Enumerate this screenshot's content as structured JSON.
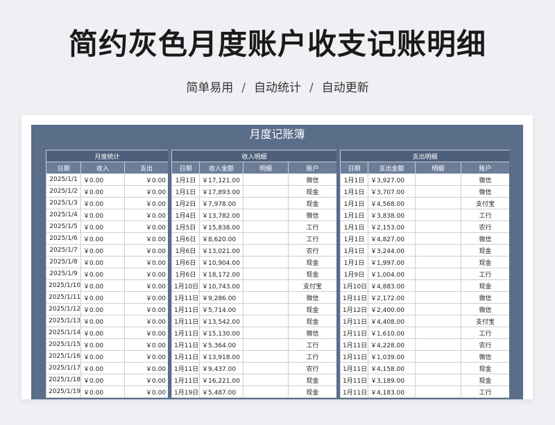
{
  "title": "简约灰色月度账户收支记账明细",
  "tags": [
    "简单易用",
    "自动统计",
    "自动更新"
  ],
  "sheet_title": "月度记账簿",
  "monthly": {
    "group_label": "月度统计",
    "headers": [
      "日期",
      "收入",
      "支出"
    ],
    "rows": [
      [
        "2025/1/1",
        "￥0.00",
        "￥0.00"
      ],
      [
        "2025/1/2",
        "￥0.00",
        "￥0.00"
      ],
      [
        "2025/1/3",
        "￥0.00",
        "￥0.00"
      ],
      [
        "2025/1/4",
        "￥0.00",
        "￥0.00"
      ],
      [
        "2025/1/5",
        "￥0.00",
        "￥0.00"
      ],
      [
        "2025/1/6",
        "￥0.00",
        "￥0.00"
      ],
      [
        "2025/1/7",
        "￥0.00",
        "￥0.00"
      ],
      [
        "2025/1/8",
        "￥0.00",
        "￥0.00"
      ],
      [
        "2025/1/9",
        "￥0.00",
        "￥0.00"
      ],
      [
        "2025/1/10",
        "￥0.00",
        "￥0.00"
      ],
      [
        "2025/1/11",
        "￥0.00",
        "￥0.00"
      ],
      [
        "2025/1/12",
        "￥0.00",
        "￥0.00"
      ],
      [
        "2025/1/13",
        "￥0.00",
        "￥0.00"
      ],
      [
        "2025/1/14",
        "￥0.00",
        "￥0.00"
      ],
      [
        "2025/1/15",
        "￥0.00",
        "￥0.00"
      ],
      [
        "2025/1/16",
        "￥0.00",
        "￥0.00"
      ],
      [
        "2025/1/17",
        "￥0.00",
        "￥0.00"
      ],
      [
        "2025/1/18",
        "￥0.00",
        "￥0.00"
      ],
      [
        "2025/1/19",
        "￥0.00",
        "￥0.00"
      ]
    ]
  },
  "income": {
    "group_label": "收入明细",
    "headers": [
      "日期",
      "收入金额",
      "明细",
      "账户"
    ],
    "rows": [
      [
        "1月1日",
        "￥17,121.00",
        "",
        "微信"
      ],
      [
        "1月1日",
        "￥17,893.00",
        "",
        "现金"
      ],
      [
        "1月2日",
        "￥7,978.00",
        "",
        "现金"
      ],
      [
        "1月4日",
        "￥13,782.00",
        "",
        "微信"
      ],
      [
        "1月5日",
        "￥15,838.00",
        "",
        "工行"
      ],
      [
        "1月6日",
        "￥8,620.00",
        "",
        "工行"
      ],
      [
        "1月6日",
        "￥13,021.00",
        "",
        "农行"
      ],
      [
        "1月6日",
        "￥10,904.00",
        "",
        "现金"
      ],
      [
        "1月6日",
        "￥18,172.00",
        "",
        "现金"
      ],
      [
        "1月10日",
        "￥10,743.00",
        "",
        "支付宝"
      ],
      [
        "1月11日",
        "￥9,286.00",
        "",
        "微信"
      ],
      [
        "1月11日",
        "￥5,714.00",
        "",
        "现金"
      ],
      [
        "1月11日",
        "￥13,542.00",
        "",
        "现金"
      ],
      [
        "1月11日",
        "￥15,130.00",
        "",
        "微信"
      ],
      [
        "1月11日",
        "￥5,364.00",
        "",
        "工行"
      ],
      [
        "1月11日",
        "￥13,918.00",
        "",
        "工行"
      ],
      [
        "1月11日",
        "￥9,437.00",
        "",
        "农行"
      ],
      [
        "1月11日",
        "￥16,221.00",
        "",
        "现金"
      ],
      [
        "1月19日",
        "￥5,487.00",
        "",
        "现金"
      ]
    ]
  },
  "expense": {
    "group_label": "支出明细",
    "headers": [
      "日期",
      "支出金额",
      "明细",
      "账户"
    ],
    "rows": [
      [
        "1月1日",
        "￥3,927.00",
        "",
        "微信"
      ],
      [
        "1月1日",
        "￥3,707.00",
        "",
        "微信"
      ],
      [
        "1月1日",
        "￥4,568.00",
        "",
        "支付宝"
      ],
      [
        "1月1日",
        "￥3,838.00",
        "",
        "工行"
      ],
      [
        "1月1日",
        "￥2,153.00",
        "",
        "农行"
      ],
      [
        "1月1日",
        "￥4,827.00",
        "",
        "微信"
      ],
      [
        "1月1日",
        "￥3,244.00",
        "",
        "现金"
      ],
      [
        "1月1日",
        "￥1,997.00",
        "",
        "现金"
      ],
      [
        "1月9日",
        "￥1,004.00",
        "",
        "工行"
      ],
      [
        "1月10日",
        "￥4,883.00",
        "",
        "现金"
      ],
      [
        "1月11日",
        "￥2,172.00",
        "",
        "微信"
      ],
      [
        "1月12日",
        "￥2,400.00",
        "",
        "微信"
      ],
      [
        "1月11日",
        "￥4,408.00",
        "",
        "支付宝"
      ],
      [
        "1月11日",
        "￥1,610.00",
        "",
        "工行"
      ],
      [
        "1月11日",
        "￥4,228.00",
        "",
        "农行"
      ],
      [
        "1月11日",
        "￥1,039.00",
        "",
        "微信"
      ],
      [
        "1月11日",
        "￥4,158.00",
        "",
        "现金"
      ],
      [
        "1月11日",
        "￥3,189.00",
        "",
        "现金"
      ],
      [
        "1月11日",
        "￥4,183.00",
        "",
        "工行"
      ]
    ]
  }
}
